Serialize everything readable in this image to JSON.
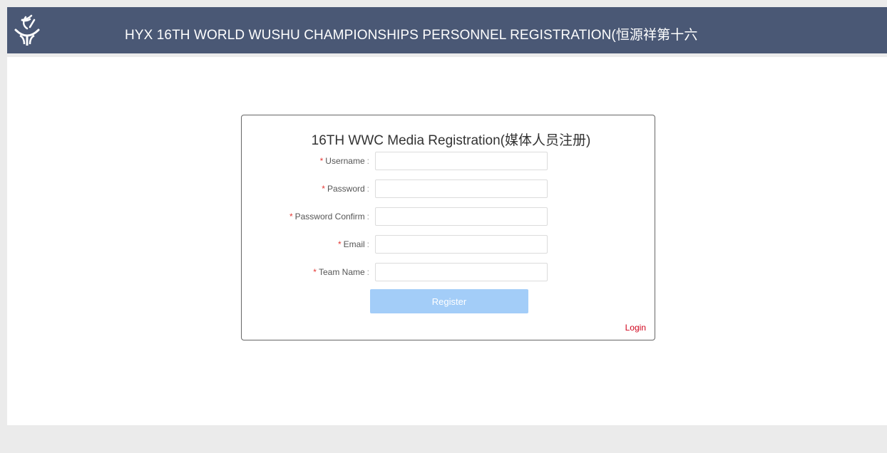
{
  "header": {
    "title": "HYX 16TH WORLD WUSHU CHAMPIONSHIPS PERSONNEL REGISTRATION(恒源祥第十六"
  },
  "form": {
    "title": "16TH WWC Media Registration(媒体人员注册)",
    "required_mark": "*",
    "colon": ":",
    "fields": [
      {
        "label": "Username",
        "value": "",
        "placeholder": ""
      },
      {
        "label": "Password",
        "value": "",
        "placeholder": ""
      },
      {
        "label": "Password Confirm",
        "value": "",
        "placeholder": ""
      },
      {
        "label": "Email",
        "value": "",
        "placeholder": ""
      },
      {
        "label": "Team Name",
        "value": "",
        "placeholder": ""
      }
    ],
    "register_label": "Register",
    "login_label": "Login"
  },
  "colors": {
    "header_bg": "#4a5875",
    "button_bg": "#a3cdf8",
    "required": "#e53935",
    "login_link": "#d0021b"
  },
  "icons": {
    "logo": "wushu-logo-icon"
  }
}
